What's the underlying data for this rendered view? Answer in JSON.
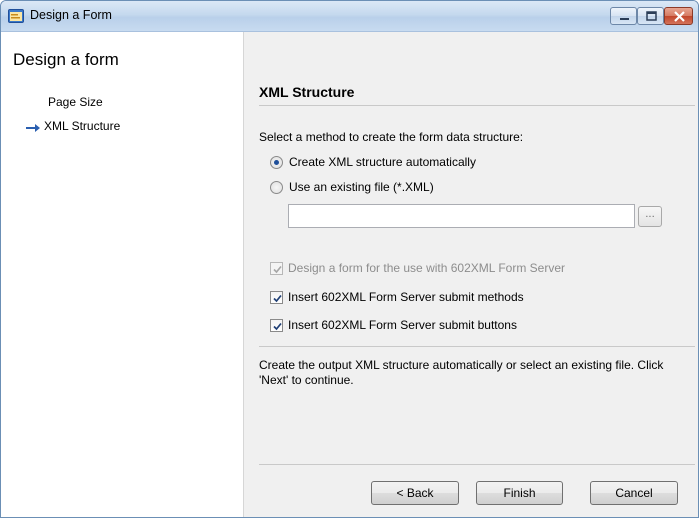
{
  "window": {
    "title": "Design a Form"
  },
  "sidebar": {
    "title": "Design a form",
    "items": [
      {
        "label": "Page Size",
        "current": false
      },
      {
        "label": "XML Structure",
        "current": true
      }
    ]
  },
  "main": {
    "title": "XML Structure",
    "prompt": "Select a method to create the form data structure:",
    "radio_auto": {
      "label": "Create XML structure automatically",
      "selected": true
    },
    "radio_file": {
      "label": "Use an existing file (*.XML)",
      "selected": false
    },
    "file_path": {
      "value": ""
    },
    "browse_label": "...",
    "check_server": {
      "label": "Design a form for the use with 602XML Form Server",
      "checked": true,
      "enabled": false
    },
    "check_methods": {
      "label": "Insert 602XML Form Server submit methods",
      "checked": true
    },
    "check_buttons": {
      "label": "Insert 602XML Form Server submit buttons",
      "checked": true
    },
    "description": "Create the output XML structure automatically or select an existing file. Click 'Next' to continue."
  },
  "buttons": {
    "back": "< Back",
    "finish": "Finish",
    "cancel": "Cancel"
  },
  "colors": {
    "accent": "#1f4f9a",
    "arrow": "#2a5fb0"
  }
}
